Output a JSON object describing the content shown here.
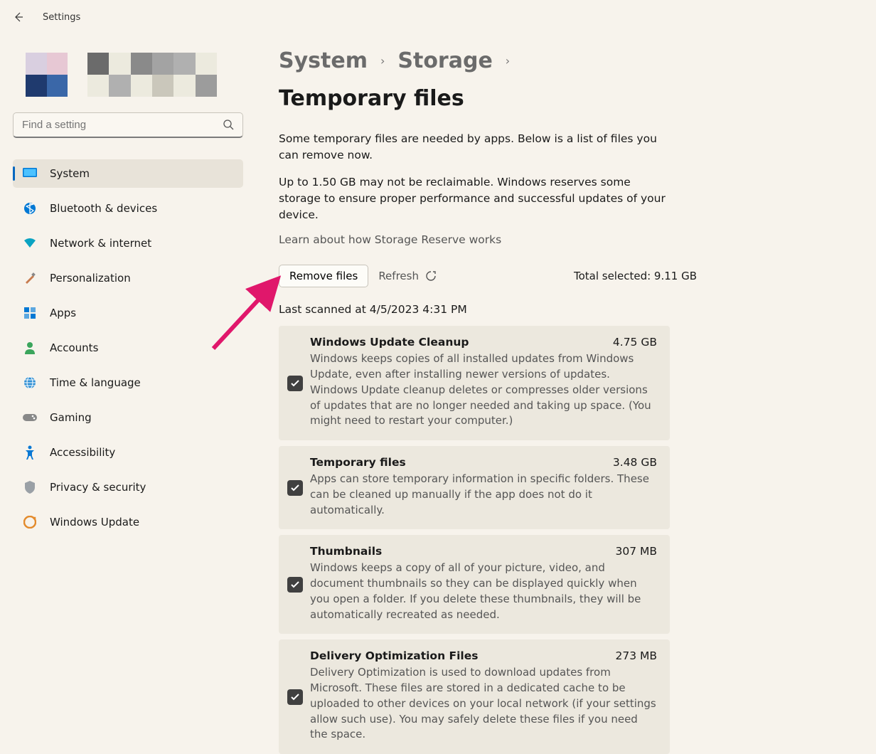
{
  "titlebar": {
    "label": "Settings"
  },
  "search": {
    "placeholder": "Find a setting"
  },
  "nav": {
    "items": [
      {
        "label": "System",
        "active": true,
        "icon": "monitor"
      },
      {
        "label": "Bluetooth & devices",
        "active": false,
        "icon": "bluetooth"
      },
      {
        "label": "Network & internet",
        "active": false,
        "icon": "wifi"
      },
      {
        "label": "Personalization",
        "active": false,
        "icon": "brush"
      },
      {
        "label": "Apps",
        "active": false,
        "icon": "apps"
      },
      {
        "label": "Accounts",
        "active": false,
        "icon": "person"
      },
      {
        "label": "Time & language",
        "active": false,
        "icon": "globe"
      },
      {
        "label": "Gaming",
        "active": false,
        "icon": "gamepad"
      },
      {
        "label": "Accessibility",
        "active": false,
        "icon": "accessibility"
      },
      {
        "label": "Privacy & security",
        "active": false,
        "icon": "shield"
      },
      {
        "label": "Windows Update",
        "active": false,
        "icon": "update"
      }
    ]
  },
  "breadcrumb": {
    "parent1": "System",
    "parent2": "Storage",
    "current": "Temporary files"
  },
  "description": {
    "p1": "Some temporary files are needed by apps. Below is a list of files you can remove now.",
    "p2": "Up to 1.50 GB may not be reclaimable. Windows reserves some storage to ensure proper performance and successful updates of your device.",
    "link": "Learn about how Storage Reserve works"
  },
  "actions": {
    "remove_label": "Remove files",
    "refresh_label": "Refresh",
    "total_label": "Total selected: 9.11 GB"
  },
  "last_scanned": "Last scanned at 4/5/2023 4:31 PM",
  "cards": [
    {
      "title": "Windows Update Cleanup",
      "size": "4.75 GB",
      "desc": "Windows keeps copies of all installed updates from Windows Update, even after installing newer versions of updates. Windows Update cleanup deletes or compresses older versions of updates that are no longer needed and taking up space. (You might need to restart your computer.)",
      "checked": true
    },
    {
      "title": "Temporary files",
      "size": "3.48 GB",
      "desc": "Apps can store temporary information in specific folders. These can be cleaned up manually if the app does not do it automatically.",
      "checked": true
    },
    {
      "title": "Thumbnails",
      "size": "307 MB",
      "desc": "Windows keeps a copy of all of your picture, video, and document thumbnails so they can be displayed quickly when you open a folder. If you delete these thumbnails, they will be automatically recreated as needed.",
      "checked": true
    },
    {
      "title": "Delivery Optimization Files",
      "size": "273 MB",
      "desc": "Delivery Optimization is used to download updates from Microsoft. These files are stored in a dedicated cache to be uploaded to other devices on your local network (if your settings allow such use). You may safely delete these files if you need the space.",
      "checked": true
    }
  ]
}
